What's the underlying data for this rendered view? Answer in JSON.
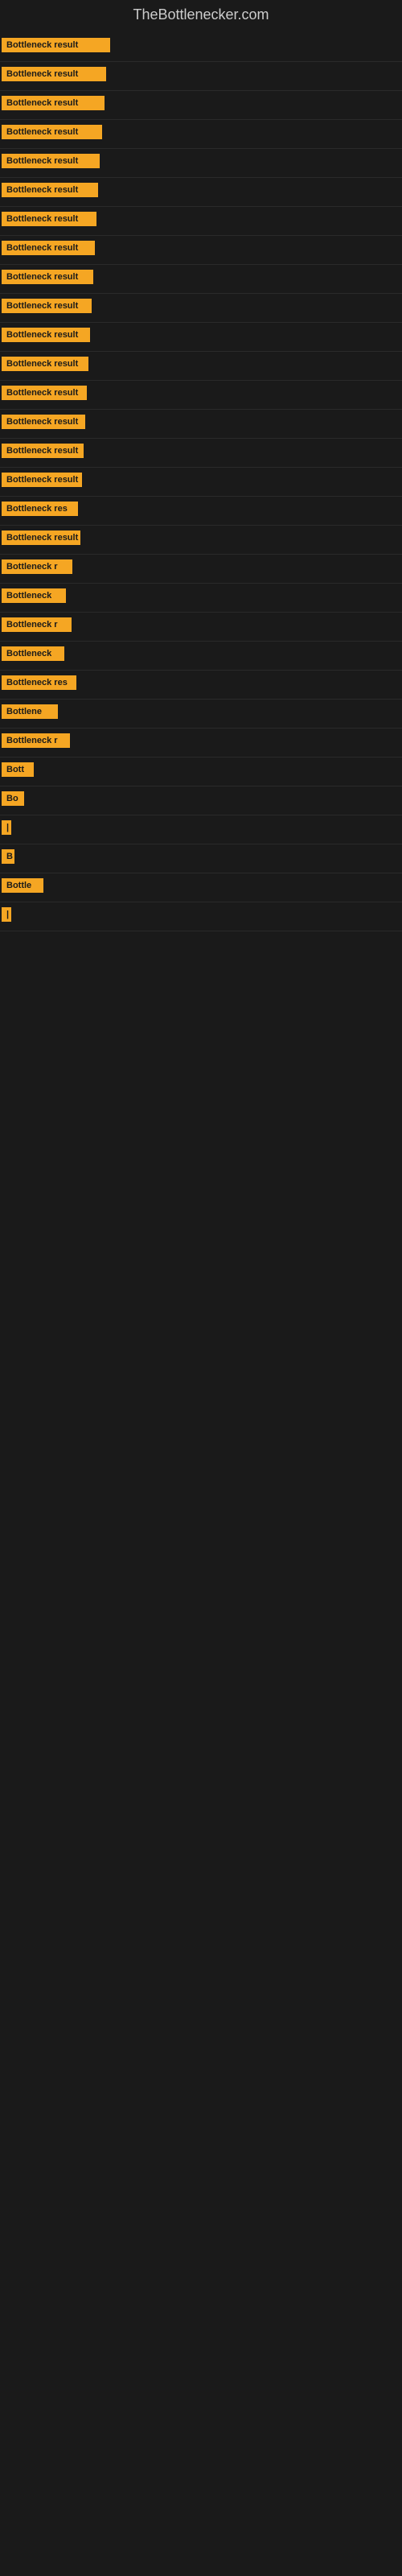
{
  "site_title": "TheBottlenecker.com",
  "bars": [
    {
      "label": "Bottleneck result",
      "width": 135
    },
    {
      "label": "Bottleneck result",
      "width": 130
    },
    {
      "label": "Bottleneck result",
      "width": 128
    },
    {
      "label": "Bottleneck result",
      "width": 125
    },
    {
      "label": "Bottleneck result",
      "width": 122
    },
    {
      "label": "Bottleneck result",
      "width": 120
    },
    {
      "label": "Bottleneck result",
      "width": 118
    },
    {
      "label": "Bottleneck result",
      "width": 116
    },
    {
      "label": "Bottleneck result",
      "width": 114
    },
    {
      "label": "Bottleneck result",
      "width": 112
    },
    {
      "label": "Bottleneck result",
      "width": 110
    },
    {
      "label": "Bottleneck result",
      "width": 108
    },
    {
      "label": "Bottleneck result",
      "width": 106
    },
    {
      "label": "Bottleneck result",
      "width": 104
    },
    {
      "label": "Bottleneck result",
      "width": 102
    },
    {
      "label": "Bottleneck result",
      "width": 100
    },
    {
      "label": "Bottleneck res",
      "width": 95
    },
    {
      "label": "Bottleneck result",
      "width": 98
    },
    {
      "label": "Bottleneck r",
      "width": 88
    },
    {
      "label": "Bottleneck",
      "width": 80
    },
    {
      "label": "Bottleneck r",
      "width": 87
    },
    {
      "label": "Bottleneck",
      "width": 78
    },
    {
      "label": "Bottleneck res",
      "width": 93
    },
    {
      "label": "Bottlene",
      "width": 70
    },
    {
      "label": "Bottleneck r",
      "width": 85
    },
    {
      "label": "Bott",
      "width": 40
    },
    {
      "label": "Bo",
      "width": 28
    },
    {
      "label": "|",
      "width": 8
    },
    {
      "label": "B",
      "width": 16
    },
    {
      "label": "Bottle",
      "width": 52
    },
    {
      "label": "|",
      "width": 6
    }
  ]
}
